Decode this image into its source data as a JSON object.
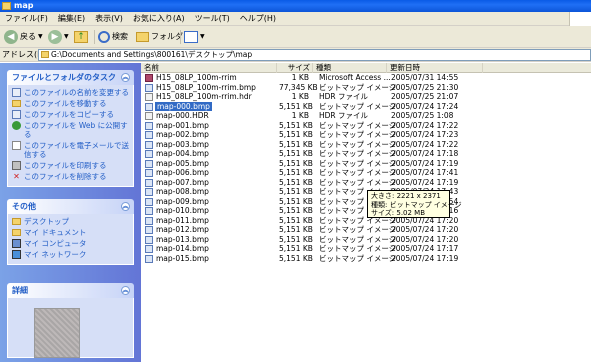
{
  "window": {
    "title": "map"
  },
  "menu": {
    "items": [
      "ファイル(F)",
      "編集(E)",
      "表示(V)",
      "お気に入り(A)",
      "ツール(T)",
      "ヘルプ(H)"
    ]
  },
  "toolbar": {
    "back_label": "戻る",
    "search_label": "検索",
    "folders_label": "フォルダ"
  },
  "address": {
    "label": "アドレス(D)",
    "path": "G:\\Documents and Settings\\800161\\デスクトップ\\map"
  },
  "tasks": {
    "title": "ファイルとフォルダのタスク",
    "items": [
      {
        "label": "このファイルの名前を変更する",
        "icon": "rename-icon"
      },
      {
        "label": "このファイルを移動する",
        "icon": "move-icon"
      },
      {
        "label": "このファイルをコピーする",
        "icon": "copy-icon"
      },
      {
        "label": "このファイルを Web に公開する",
        "icon": "web-icon"
      },
      {
        "label": "このファイルを電子メールで送信する",
        "icon": "email-icon"
      },
      {
        "label": "このファイルを印刷する",
        "icon": "print-icon"
      },
      {
        "label": "このファイルを削除する",
        "icon": "delete-icon"
      }
    ]
  },
  "other": {
    "title": "その他",
    "items": [
      {
        "label": "デスクトップ",
        "icon": "desktop-icon"
      },
      {
        "label": "マイ ドキュメント",
        "icon": "my-documents-icon"
      },
      {
        "label": "マイ コンピュータ",
        "icon": "my-computer-icon"
      },
      {
        "label": "マイ ネットワーク",
        "icon": "my-network-icon"
      }
    ]
  },
  "details": {
    "title": "詳細"
  },
  "columns": {
    "name": "名前",
    "size": "サイズ",
    "type": "種類",
    "date": "更新日時"
  },
  "files": [
    {
      "name": "H15_08LP_100m-rrim",
      "size": "1 KB",
      "type": "Microsoft Access ...",
      "date": "2005/07/31 14:55",
      "icon": "access"
    },
    {
      "name": "H15_08LP_100m-rrim.bmp",
      "size": "77,345 KB",
      "type": "ビットマップ イメージ",
      "date": "2005/07/25 21:30",
      "icon": "bmp"
    },
    {
      "name": "H15_08LP_100m-rrim.hdr",
      "size": "1 KB",
      "type": "HDR ファイル",
      "date": "2005/07/25 21:07",
      "icon": "hdr"
    },
    {
      "name": "map-000.bmp",
      "size": "5,151 KB",
      "type": "ビットマップ イメージ",
      "date": "2005/07/24 17:24",
      "icon": "bmp",
      "selected": true
    },
    {
      "name": "map-000.HDR",
      "size": "1 KB",
      "type": "HDR ファイル",
      "date": "2005/07/25 1:08",
      "icon": "hdr"
    },
    {
      "name": "map-001.bmp",
      "size": "5,151 KB",
      "type": "ビットマップ イメージ",
      "date": "2005/07/24 17:22",
      "icon": "bmp"
    },
    {
      "name": "map-002.bmp",
      "size": "5,151 KB",
      "type": "ビットマップ イメージ",
      "date": "2005/07/24 17:23",
      "icon": "bmp"
    },
    {
      "name": "map-003.bmp",
      "size": "5,151 KB",
      "type": "ビットマップ イメージ",
      "date": "2005/07/24 17:22",
      "icon": "bmp"
    },
    {
      "name": "map-004.bmp",
      "size": "5,151 KB",
      "type": "ビットマップ イメージ",
      "date": "2005/07/24 17:18",
      "icon": "bmp"
    },
    {
      "name": "map-005.bmp",
      "size": "5,151 KB",
      "type": "ビットマップ イメージ",
      "date": "2005/07/24 17:19",
      "icon": "bmp"
    },
    {
      "name": "map-006.bmp",
      "size": "5,151 KB",
      "type": "ビットマップ イメージ",
      "date": "2005/07/24 17:41",
      "icon": "bmp"
    },
    {
      "name": "map-007.bmp",
      "size": "5,151 KB",
      "type": "ビットマップ イメージ",
      "date": "2005/07/24 17:19",
      "icon": "bmp"
    },
    {
      "name": "map-008.bmp",
      "size": "5,151 KB",
      "type": "ビットマップ イメージ",
      "date": "2005/07/24 17:43",
      "icon": "bmp"
    },
    {
      "name": "map-009.bmp",
      "size": "5,151 KB",
      "type": "ビットマップ イメージ",
      "date": "2005/07/24 17:54",
      "icon": "bmp"
    },
    {
      "name": "map-010.bmp",
      "size": "5,151 KB",
      "type": "ビットマップ イメージ",
      "date": "2005/07/24 17:16",
      "icon": "bmp"
    },
    {
      "name": "map-011.bmp",
      "size": "5,151 KB",
      "type": "ビットマップ イメージ",
      "date": "2005/07/24 17:20",
      "icon": "bmp"
    },
    {
      "name": "map-012.bmp",
      "size": "5,151 KB",
      "type": "ビットマップ イメージ",
      "date": "2005/07/24 17:20",
      "icon": "bmp"
    },
    {
      "name": "map-013.bmp",
      "size": "5,151 KB",
      "type": "ビットマップ イメージ",
      "date": "2005/07/24 17:20",
      "icon": "bmp"
    },
    {
      "name": "map-014.bmp",
      "size": "5,151 KB",
      "type": "ビットマップ イメージ",
      "date": "2005/07/24 17:17",
      "icon": "bmp"
    },
    {
      "name": "map-015.bmp",
      "size": "5,151 KB",
      "type": "ビットマップ イメージ",
      "date": "2005/07/24 17:19",
      "icon": "bmp"
    }
  ],
  "tooltip": {
    "dimensions": "大きさ: 2221 x 2371",
    "type": "種類: ビットマップ イメージ",
    "size": "サイズ: 5.02 MB"
  }
}
